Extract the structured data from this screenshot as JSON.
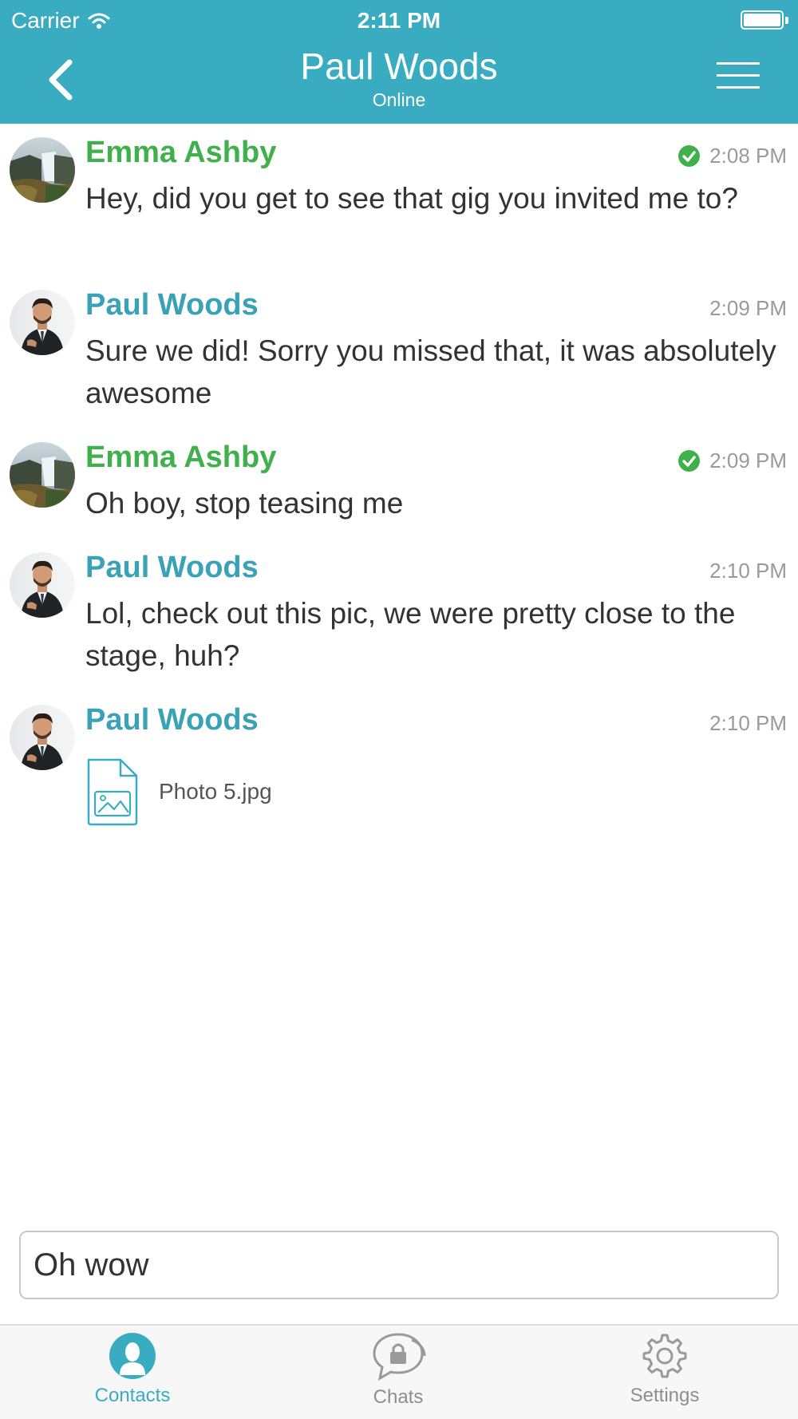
{
  "status_bar": {
    "carrier": "Carrier",
    "time": "2:11 PM"
  },
  "nav": {
    "title": "Paul Woods",
    "subtitle": "Online"
  },
  "colors": {
    "accent": "#3aacc1",
    "emma": "#3fb04b",
    "paul": "#3aa2b6",
    "check": "#3fb04b",
    "inactive": "#8e8e8e"
  },
  "messages": [
    {
      "author": "Emma Ashby",
      "time": "2:08 PM",
      "text": "Hey, did you get to see that gig you invited me to?",
      "delivered": true
    },
    {
      "author": "Paul Woods",
      "time": "2:09 PM",
      "text": "Sure we did! Sorry you missed that, it was absolutely awesome",
      "delivered": false
    },
    {
      "author": "Emma Ashby",
      "time": "2:09 PM",
      "text": "Oh boy, stop teasing me",
      "delivered": true
    },
    {
      "author": "Paul Woods",
      "time": "2:10 PM",
      "text": "Lol, check out this pic, we were pretty close to the stage, huh?",
      "delivered": false
    },
    {
      "author": "Paul Woods",
      "time": "2:10 PM",
      "attachment": "Photo 5.jpg",
      "delivered": false
    }
  ],
  "composer": {
    "value": "Oh wow"
  },
  "tabs": [
    {
      "label": "Contacts",
      "icon": "contact-icon",
      "active": true
    },
    {
      "label": "Chats",
      "icon": "chat-lock-icon",
      "active": false
    },
    {
      "label": "Settings",
      "icon": "gear-icon",
      "active": false
    }
  ]
}
